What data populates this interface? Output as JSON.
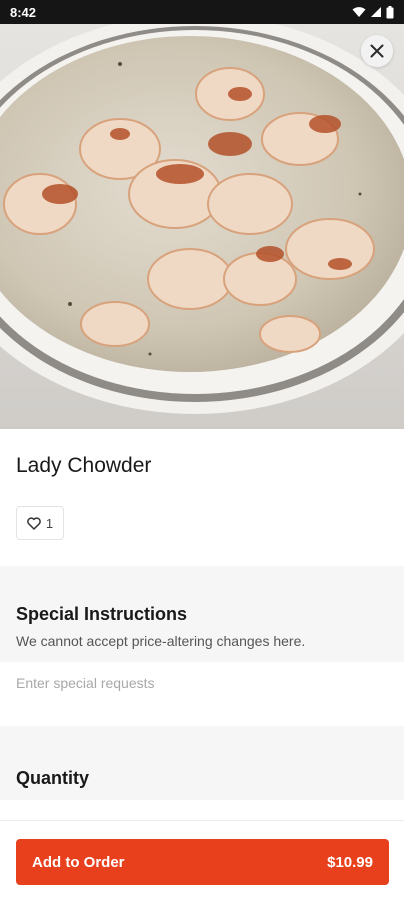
{
  "status_bar": {
    "time": "8:42"
  },
  "item": {
    "name": "Lady Chowder",
    "like_count": "1"
  },
  "special_instructions": {
    "title": "Special Instructions",
    "subtitle": "We cannot accept price-altering changes here.",
    "placeholder": "Enter special requests",
    "value": ""
  },
  "quantity": {
    "title": "Quantity"
  },
  "cta": {
    "label": "Add to Order",
    "price": "$10.99"
  },
  "colors": {
    "accent": "#e8401c",
    "section_background": "#f6f6f6"
  },
  "icons": {
    "close": "close-icon",
    "like": "heart-icon",
    "wifi": "wifi-icon",
    "signal": "signal-icon",
    "battery": "battery-icon"
  }
}
